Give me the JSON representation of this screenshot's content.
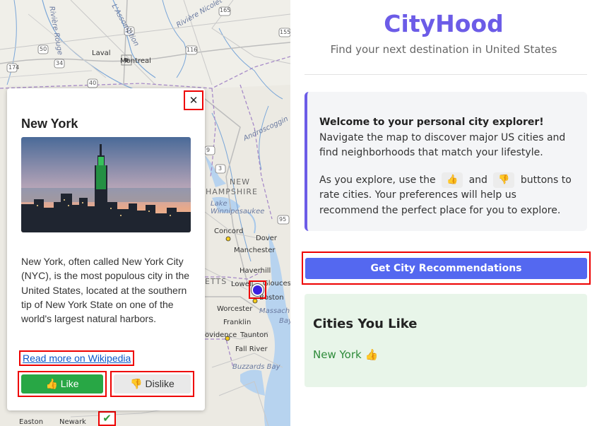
{
  "app": {
    "title": "CityHood",
    "subtitle": "Find your next destination in United States"
  },
  "welcome": {
    "lead": "Welcome to your personal city explorer!",
    "lead_rest": " Navigate the map to discover major US cities and find neighborhoods that match your lifestyle.",
    "rate_prefix": "As you explore, use the",
    "rate_and": "and",
    "rate_suffix": "buttons to rate cities. Your preferences will help us recommend the perfect place for you to explore.",
    "like_chip": "👍",
    "dislike_chip": "👎"
  },
  "actions": {
    "recommend_label": "Get City Recommendations"
  },
  "liked": {
    "title": "Cities You Like",
    "items": [
      "New York 👍"
    ]
  },
  "popup": {
    "close_label": "✕",
    "city": "New York",
    "description": "New York, often called New York City (NYC), is the most populous city in the United States, located at the southern tip of New York State on one of the world's largest natural harbors.",
    "wiki_link": "Read more on Wikipedia",
    "like_label": "👍 Like",
    "dislike_label": "👎 Dislike"
  },
  "map": {
    "labels": {
      "laval": "Laval",
      "montreal": "Montreal",
      "riviere_nicolet": "Rivière Nicolet",
      "riviere_rouge": "Rivière Rouge",
      "assomption": "L'Assomption",
      "new_hampshire_1": "NEW",
      "new_hampshire_2": "HAMPSHIRE",
      "lake_winni": "Lake",
      "winni_2": "Winnipesaukee",
      "androscoggin": "Androscoggin",
      "concord": "Concord",
      "dover": "Dover",
      "manchester": "Manchester",
      "haverhill": "Haverhill",
      "lowell": "Lowell",
      "gloucester": "Gloucester",
      "worcester": "Worcester",
      "boston": "Boston",
      "massachusetts": "Massach",
      "bay": "Bay",
      "franklin": "Franklin",
      "providence": "ovidence",
      "taunton": "Taunton",
      "fall_river": "Fall River",
      "buzzards_bay": "Buzzards Bay",
      "easton": "Easton",
      "newark": "Newark",
      "etts": "ETTS"
    },
    "route_numbers": [
      "165",
      "155",
      "50",
      "116",
      "34",
      "40",
      "55",
      "105",
      "20",
      "125",
      "15",
      "174",
      "3",
      "95",
      "9"
    ],
    "marker_color": "#3b22e0",
    "liked_marker": "✔"
  },
  "colors": {
    "accent": "#6c5ce7",
    "button": "#5468f0",
    "like": "#28a745",
    "liked_text": "#2e8b3a"
  }
}
